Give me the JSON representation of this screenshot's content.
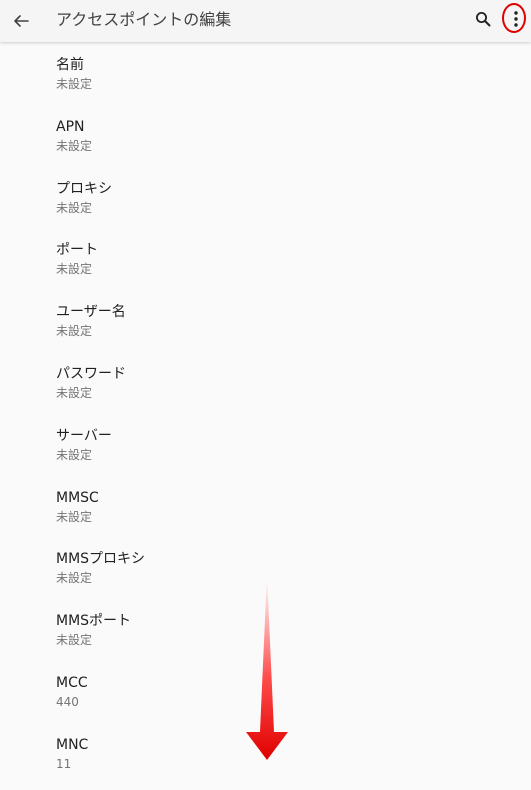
{
  "app_bar": {
    "title": "アクセスポイントの編集",
    "back_icon": "arrow-back-icon",
    "search_icon": "search-icon",
    "more_icon": "more-vert-icon"
  },
  "annotation": {
    "highlight_color": "#e00000",
    "arrow_color": "#ff1a1a",
    "arrow_direction": "down"
  },
  "fields": [
    {
      "title": "名前",
      "summary": "未設定"
    },
    {
      "title": "APN",
      "summary": "未設定"
    },
    {
      "title": "プロキシ",
      "summary": "未設定"
    },
    {
      "title": "ポート",
      "summary": "未設定"
    },
    {
      "title": "ユーザー名",
      "summary": "未設定"
    },
    {
      "title": "パスワード",
      "summary": "未設定"
    },
    {
      "title": "サーバー",
      "summary": "未設定"
    },
    {
      "title": "MMSC",
      "summary": "未設定"
    },
    {
      "title": "MMSプロキシ",
      "summary": "未設定"
    },
    {
      "title": "MMSポート",
      "summary": "未設定"
    },
    {
      "title": "MCC",
      "summary": "440"
    },
    {
      "title": "MNC",
      "summary": "11"
    }
  ]
}
